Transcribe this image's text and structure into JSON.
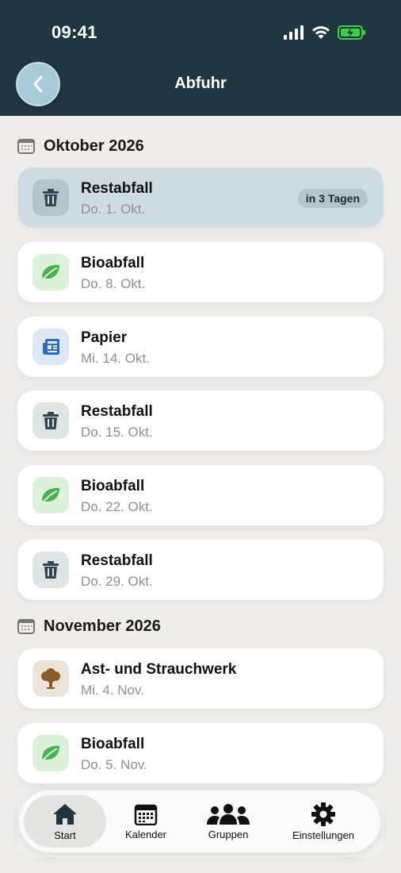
{
  "status_bar": {
    "time": "09:41"
  },
  "header": {
    "title": "Abfuhr"
  },
  "months": [
    {
      "label": "Oktober 2026",
      "items": [
        {
          "type": "rest",
          "title": "Restabfall",
          "date": "Do. 1. Okt.",
          "badge": "in 3 Tagen",
          "highlight": true
        },
        {
          "type": "bio",
          "title": "Bioabfall",
          "date": "Do. 8. Okt."
        },
        {
          "type": "papier",
          "title": "Papier",
          "date": "Mi. 14. Okt."
        },
        {
          "type": "rest",
          "title": "Restabfall",
          "date": "Do. 15. Okt."
        },
        {
          "type": "bio",
          "title": "Bioabfall",
          "date": "Do. 22. Okt."
        },
        {
          "type": "rest",
          "title": "Restabfall",
          "date": "Do. 29. Okt."
        }
      ]
    },
    {
      "label": "November 2026",
      "items": [
        {
          "type": "ast",
          "title": "Ast- und Strauchwerk",
          "date": "Mi. 4. Nov."
        },
        {
          "type": "bio",
          "title": "Bioabfall",
          "date": "Do. 5. Nov."
        }
      ]
    }
  ],
  "tabbar": {
    "tabs": [
      {
        "label": "Start",
        "icon": "home-icon",
        "active": true
      },
      {
        "label": "Kalender",
        "icon": "calendar-icon"
      },
      {
        "label": "Gruppen",
        "icon": "groups-icon"
      },
      {
        "label": "Einstellungen",
        "icon": "gear-icon"
      }
    ]
  },
  "colors": {
    "header_bg": "#223642",
    "page_bg": "#eeedeb",
    "highlight_card": "#cfdbe3",
    "bio_green": "#4caf50",
    "papier_blue": "#2f6db3",
    "ast_brown": "#8a5a2b",
    "battery_green": "#3fd04a"
  }
}
